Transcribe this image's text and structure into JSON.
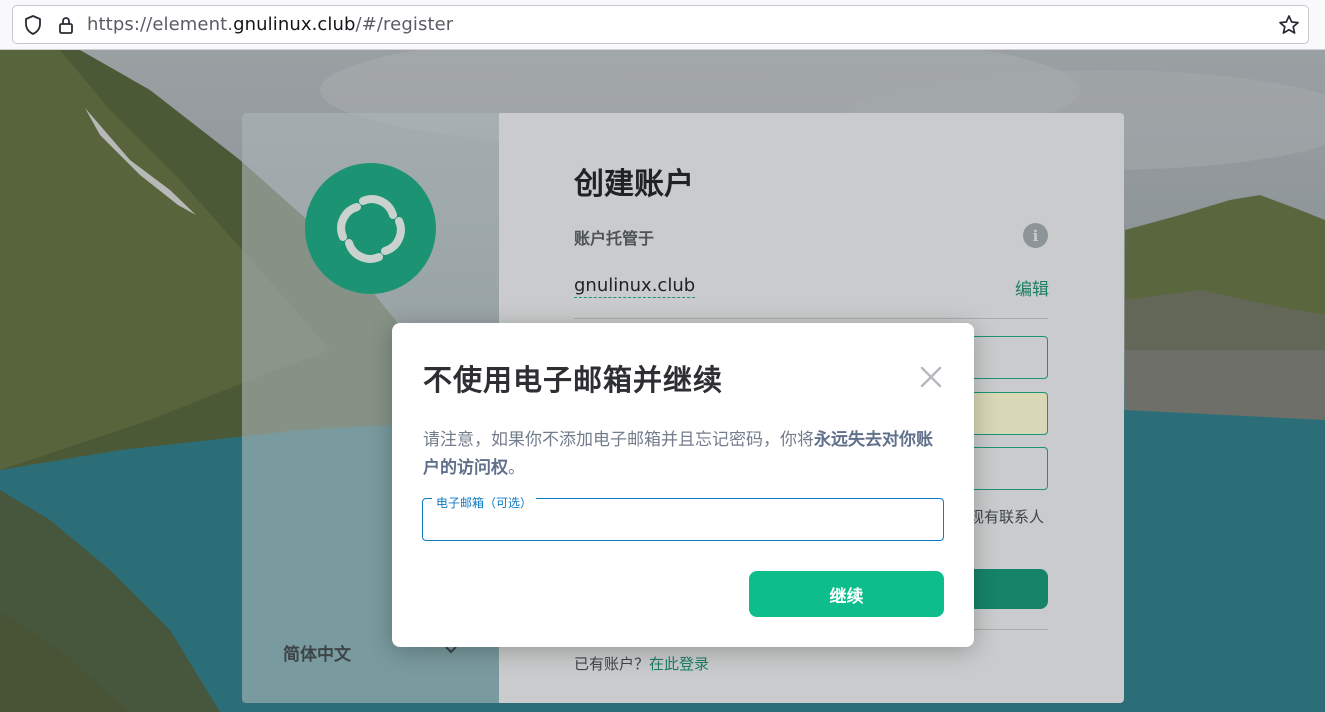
{
  "browser": {
    "url_prefix": "https://element.",
    "url_domain": "gnulinux.club",
    "url_suffix": "/#/register"
  },
  "register": {
    "title": "创建账户",
    "hosted_label": "账户托管于",
    "server_name": "gnulinux.club",
    "edit_label": "编辑",
    "contact_hint": "现有联系人",
    "have_account_prefix": "已有账户？",
    "sign_in_link": "在此登录",
    "language": "简体中文"
  },
  "modal": {
    "title": "不使用电子邮箱并继续",
    "text_plain": "请注意，如果你不添加电子邮箱并且忘记密码，你将",
    "text_bold": "永远失去对你账户的访问权",
    "text_end": "。",
    "email_label": "电子邮箱（可选）",
    "email_value": "",
    "continue_label": "继续"
  },
  "colors": {
    "accent": "#0dbd8b",
    "logo_bg": "#1c9473",
    "focus_blue": "#0d7ac4"
  }
}
